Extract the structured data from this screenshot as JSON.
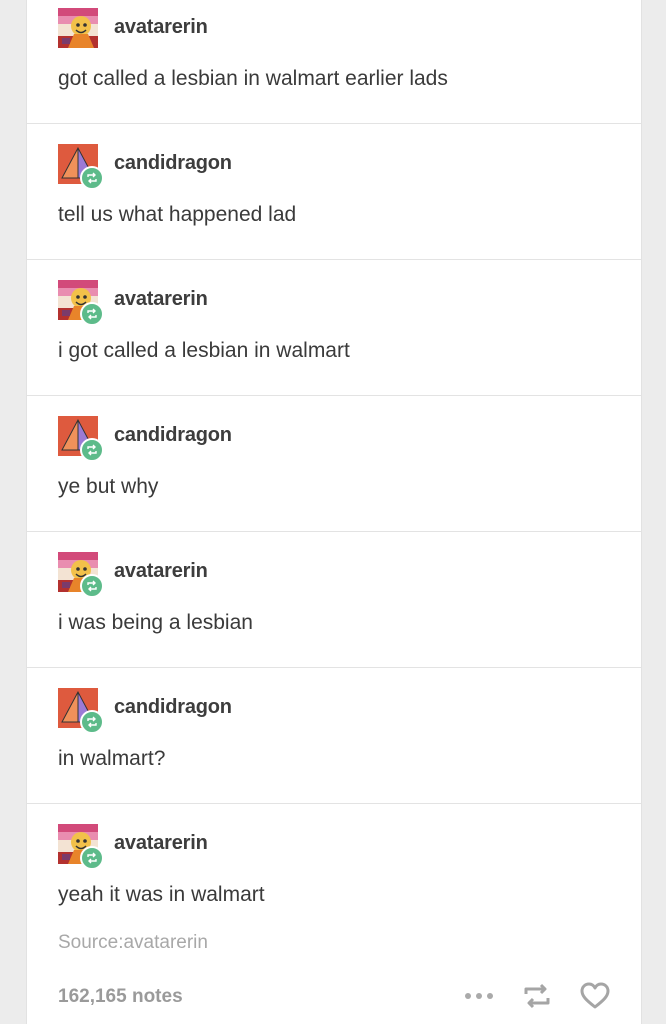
{
  "thread": [
    {
      "username": "avatarerin",
      "text": "got called a lesbian in walmart earlier lads",
      "avatar": "avatarerin-avatar",
      "reblog": false
    },
    {
      "username": "candidragon",
      "text": "tell us what happened lad",
      "avatar": "candidragon-avatar",
      "reblog": true
    },
    {
      "username": "avatarerin",
      "text": "i got called a lesbian in walmart",
      "avatar": "avatarerin-avatar",
      "reblog": true
    },
    {
      "username": "candidragon",
      "text": "ye but why",
      "avatar": "candidragon-avatar",
      "reblog": true
    },
    {
      "username": "avatarerin",
      "text": "i was being a lesbian",
      "avatar": "avatarerin-avatar",
      "reblog": true
    },
    {
      "username": "candidragon",
      "text": "in walmart?",
      "avatar": "candidragon-avatar",
      "reblog": true
    },
    {
      "username": "avatarerin",
      "text": "yeah it was in walmart",
      "avatar": "avatarerin-avatar",
      "reblog": true
    }
  ],
  "source": {
    "label": "Source:",
    "name": "avatarerin"
  },
  "footer": {
    "notes": "162,165 notes",
    "icons": [
      "more-icon",
      "reblog-icon",
      "heart-icon"
    ]
  },
  "colors": {
    "reblog_badge": "#5dbb8a",
    "username": "#3d3d3d",
    "text": "#3a3a3a",
    "muted": "#a8a8a8"
  }
}
